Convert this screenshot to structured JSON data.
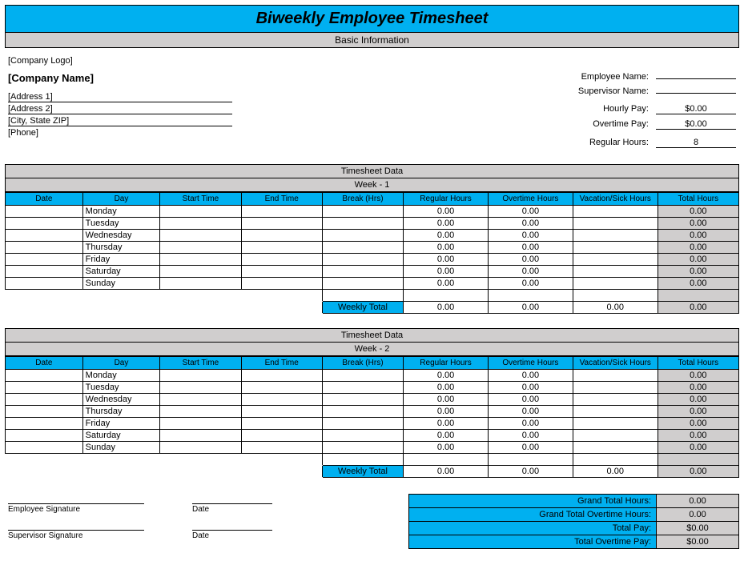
{
  "title": "Biweekly Employee Timesheet",
  "subtitle": "Basic Information",
  "company": {
    "logo": "[Company Logo]",
    "name": "[Company Name]",
    "address1": "[Address 1]",
    "address2": "[Address 2]",
    "citystate": "[City, State ZIP]",
    "phone": "[Phone]"
  },
  "employee": {
    "name_label": "Employee Name:",
    "name_value": "",
    "supervisor_label": "Supervisor Name:",
    "supervisor_value": "",
    "hourly_label": "Hourly Pay:",
    "hourly_value": "$0.00",
    "overtime_label": "Overtime Pay:",
    "overtime_value": "$0.00",
    "regular_label": "Regular Hours:",
    "regular_value": "8"
  },
  "ts_header": "Timesheet Data",
  "week1_label": "Week -  1",
  "week2_label": "Week -  2",
  "cols": {
    "date": "Date",
    "day": "Day",
    "start": "Start Time",
    "end": "End Time",
    "break": "Break (Hrs)",
    "reg": "Regular Hours",
    "ot": "Overtime Hours",
    "vac": "Vacation/Sick Hours",
    "total": "Total Hours"
  },
  "days": [
    "Monday",
    "Tuesday",
    "Wednesday",
    "Thursday",
    "Friday",
    "Saturday",
    "Sunday"
  ],
  "zero": "0.00",
  "weekly_total_label": "Weekly Total",
  "signatures": {
    "emp": "Employee Signature",
    "sup": "Supervisor Signature",
    "date": "Date"
  },
  "totals": {
    "grand_hours_label": "Grand Total Hours:",
    "grand_hours_value": "0.00",
    "grand_ot_label": "Grand Total Overtime Hours:",
    "grand_ot_value": "0.00",
    "total_pay_label": "Total Pay:",
    "total_pay_value": "$0.00",
    "total_ot_pay_label": "Total Overtime Pay:",
    "total_ot_pay_value": "$0.00"
  }
}
